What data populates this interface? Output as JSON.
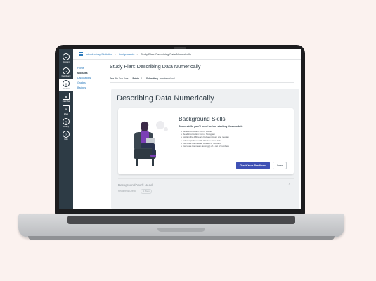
{
  "global_nav": [
    {
      "label": "Account",
      "icon": "account-icon"
    },
    {
      "label": "Dashboard",
      "icon": "dashboard-icon"
    },
    {
      "label": "Courses",
      "icon": "courses-icon"
    },
    {
      "label": "Calendar",
      "icon": "calendar-icon"
    },
    {
      "label": "Inbox",
      "icon": "inbox-icon"
    },
    {
      "label": "History",
      "icon": "history-icon"
    },
    {
      "label": "Help",
      "icon": "help-icon"
    }
  ],
  "breadcrumb": {
    "course": "Introductory Statistics",
    "section": "Assignments",
    "current": "Study Plan: Describing Data Numerically"
  },
  "course_nav": [
    "Home",
    "Modules",
    "Discussions",
    "Grades",
    "Badges"
  ],
  "assignment": {
    "title": "Study Plan: Describing Data Numerically",
    "due_label": "Due",
    "due_value": "No Due Date",
    "points_label": "Points",
    "points_value": "0",
    "submitting_label": "Submitting",
    "submitting_value": "an external tool"
  },
  "panel": {
    "title": "Describing Data Numerically",
    "card": {
      "title": "Background Skills",
      "subtitle": "Some skills you'll need before starting this module",
      "skills": [
        "Read information from a dotplot",
        "Read information from a histogram",
        "Explain the difference between mean and median",
        "Solve a problem with absolute value in it",
        "Calculate the median of a set of numbers",
        "Calculate the mean (average) of a set of numbers"
      ],
      "primary_button": "Check Your Readiness",
      "secondary_button": "Later"
    },
    "section": {
      "title": "Background You'll Need",
      "subtitle": "Readiness Check",
      "badge": "Todo"
    }
  },
  "colors": {
    "page_background": "#fbf2ef",
    "nav_dark": "#2d3b45",
    "link_blue": "#2b7abc",
    "primary_button": "#3f51b5"
  }
}
